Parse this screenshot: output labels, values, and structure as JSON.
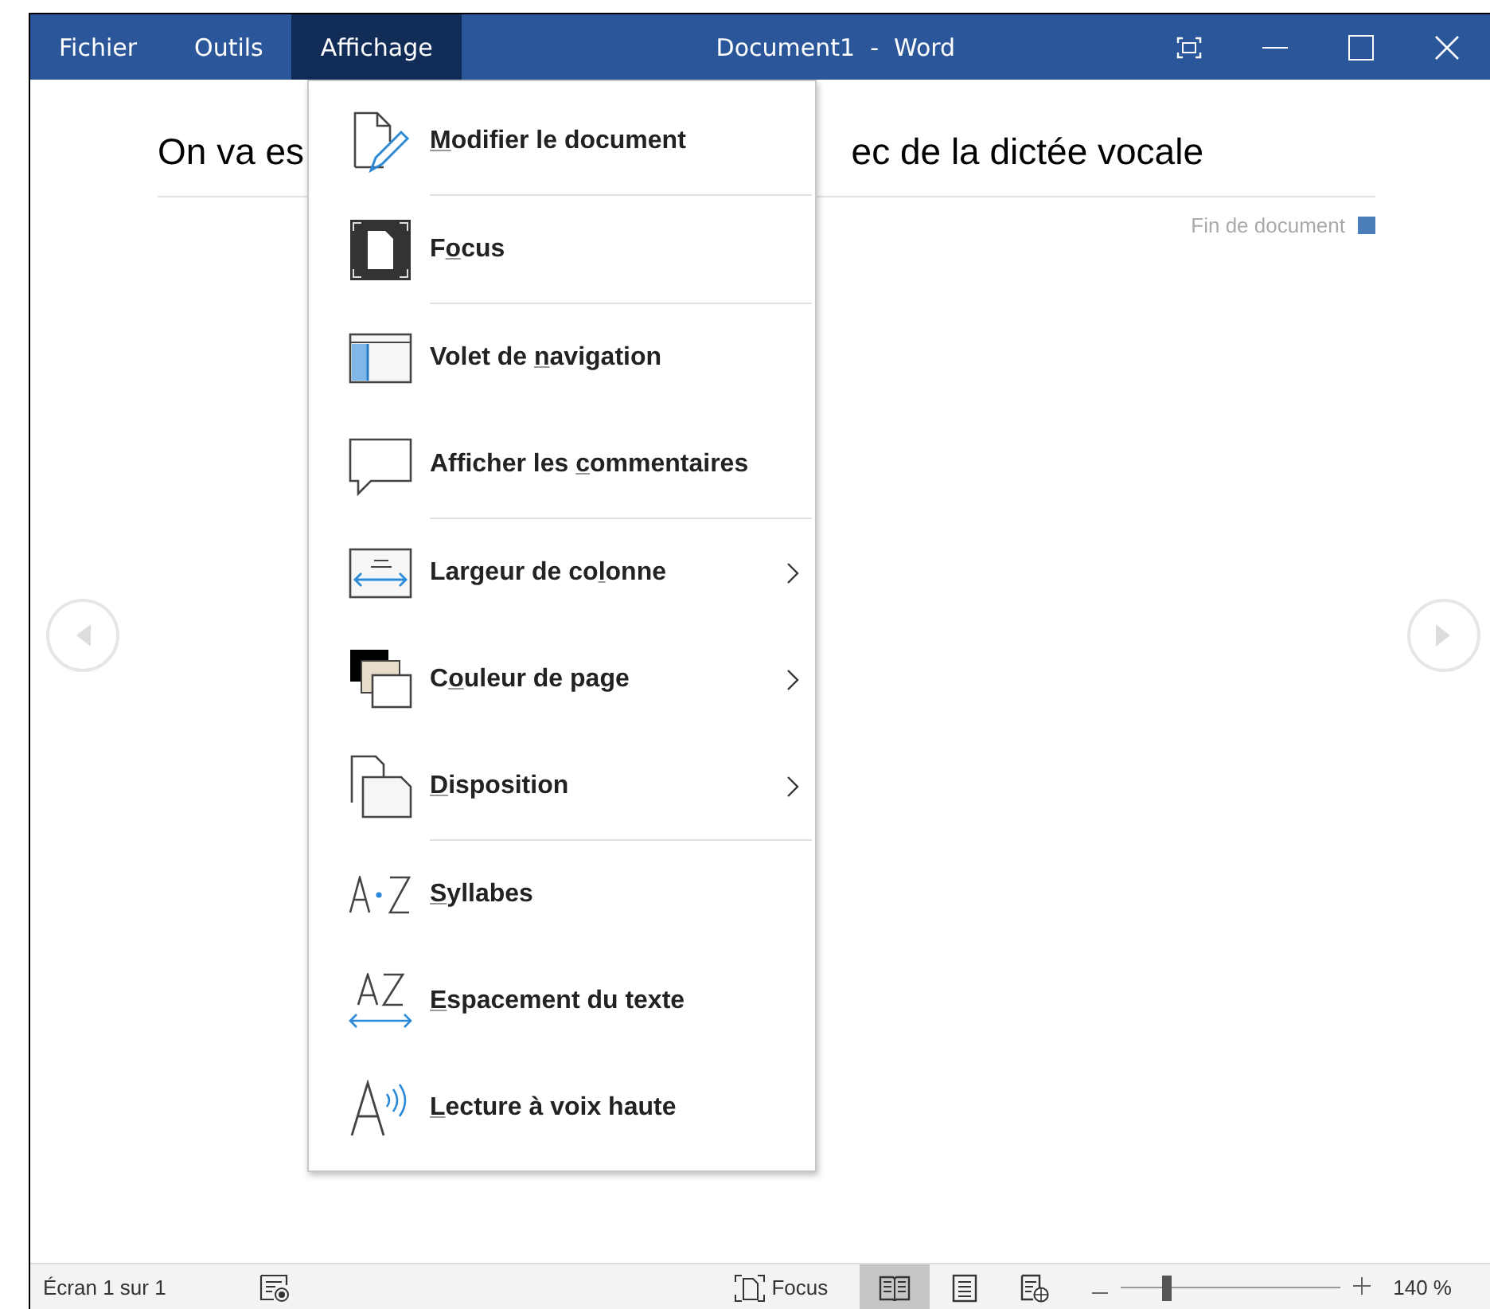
{
  "menubar": [
    {
      "label": "Fichier",
      "selected": false
    },
    {
      "label": "Outils",
      "selected": false
    },
    {
      "label": "Affichage",
      "selected": true
    }
  ],
  "window": {
    "title": "Document1  -  Word"
  },
  "document": {
    "text_before_menu": "On va es",
    "text_after_menu": "ec de la dictée vocale",
    "end_marker": "Fin de document"
  },
  "menu": {
    "items": [
      {
        "key": "M",
        "after": "odifier le document",
        "submenu": false,
        "divider_after": true
      },
      {
        "before": "F",
        "key": "o",
        "after": "cus",
        "submenu": false,
        "divider_after": true
      },
      {
        "before": "Volet de ",
        "key": "n",
        "after": "avigation",
        "submenu": false,
        "divider_after": false
      },
      {
        "before": "Afficher les ",
        "key": "c",
        "after": "ommentaires",
        "submenu": false,
        "divider_after": true
      },
      {
        "before": "Largeur de co",
        "key": "l",
        "after": "onne",
        "submenu": true,
        "divider_after": false
      },
      {
        "before": "C",
        "key": "o",
        "after": "uleur de page",
        "submenu": true,
        "divider_after": false
      },
      {
        "key": "D",
        "after": "isposition",
        "submenu": true,
        "divider_after": true
      },
      {
        "key": "S",
        "after": "yllabes",
        "submenu": false,
        "divider_after": false
      },
      {
        "key": "E",
        "after": "spacement du texte",
        "submenu": false,
        "divider_after": false
      },
      {
        "key": "L",
        "after": "ecture à voix haute",
        "submenu": false,
        "divider_after": false
      }
    ]
  },
  "status_bar": {
    "page": "Écran 1 sur 1",
    "focus": "Focus",
    "views": [
      {
        "selected": true
      },
      {
        "selected": false
      },
      {
        "selected": false
      }
    ],
    "zoom": {
      "level": 0.21,
      "reading": "140 %"
    }
  }
}
